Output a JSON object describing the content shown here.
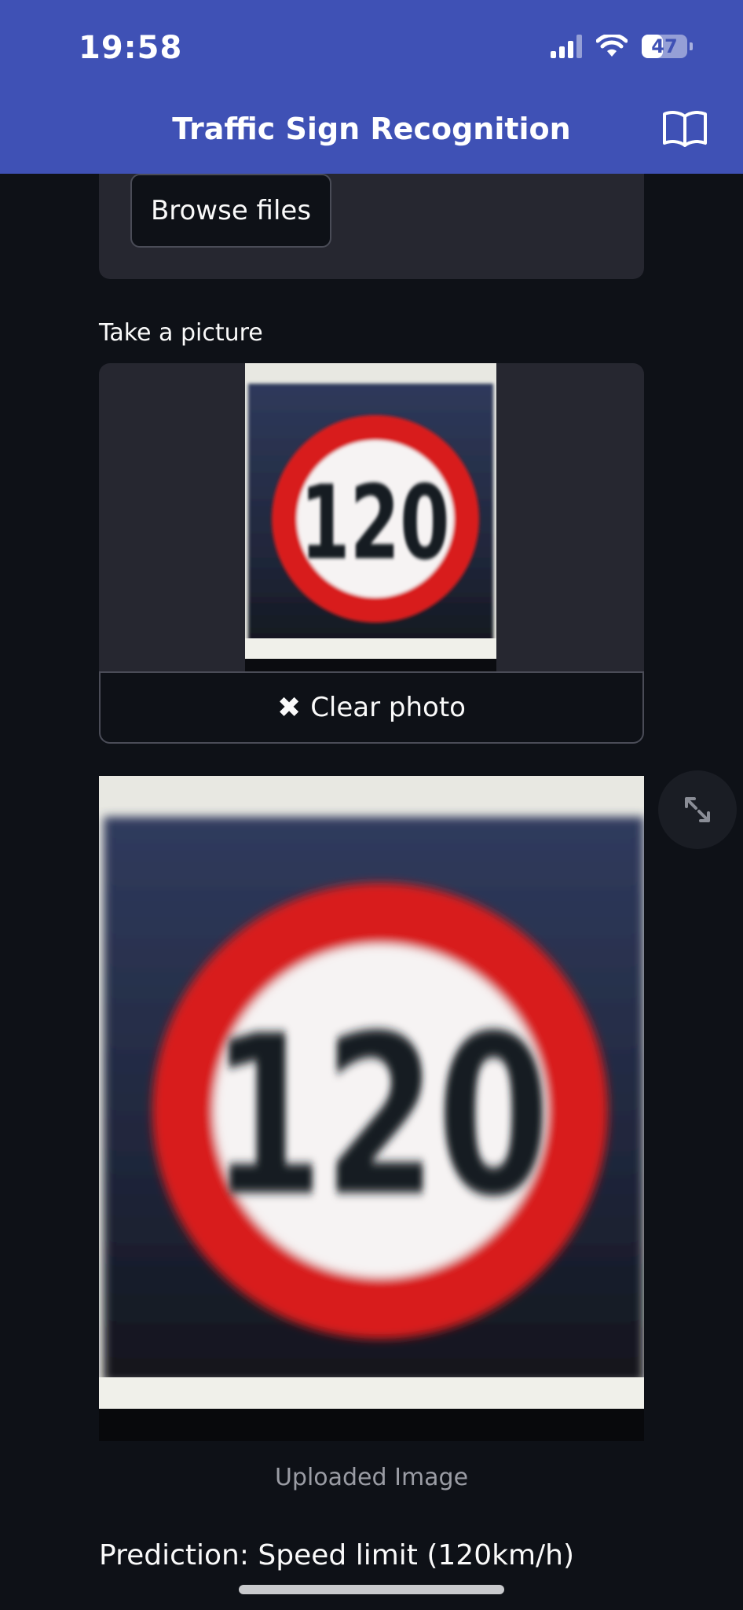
{
  "status_bar": {
    "time": "19:58",
    "battery_level": "47",
    "battery_fraction": 0.47,
    "signal_bars": 3,
    "icons": [
      "cellular-signal-icon",
      "wifi-icon",
      "battery-icon"
    ]
  },
  "header": {
    "title": "Traffic Sign Recognition",
    "icon": "book-icon",
    "background": "#3f51b5"
  },
  "uploader": {
    "browse_label": "Browse files"
  },
  "camera": {
    "label": "Take a picture",
    "clear_label": "Clear photo",
    "clear_icon": "close-icon"
  },
  "result": {
    "image_caption": "Uploaded Image",
    "fullscreen_icon": "fullscreen-icon",
    "prediction": "Prediction: Speed limit (120km/h)"
  },
  "sign": {
    "number": "120"
  },
  "theme": {
    "background": "#0e1117",
    "panel": "#262730",
    "text": "#fafafa",
    "muted": "#9a9ca4",
    "sign_red": "#d81e1e"
  }
}
